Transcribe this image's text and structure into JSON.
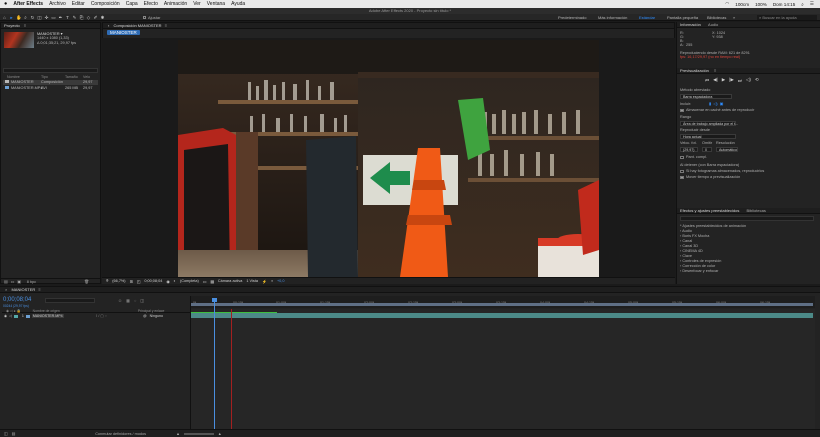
{
  "menubar": {
    "app": "After Effects",
    "items": [
      "Archivo",
      "Editar",
      "Composición",
      "Capa",
      "Efecto",
      "Animación",
      "Ver",
      "Ventana",
      "Ayuda"
    ],
    "zoom": "100%",
    "battery": "100cm",
    "clock": "Dom 14:15"
  },
  "window_title": "Adobe After Effects 2020 - Proyecto sin título *",
  "toolbar": {
    "align_label": "Ajustar",
    "workspaces": [
      "Predeterminado",
      "Más información",
      "Estándar",
      "Pantalla pequeña",
      "Bibliotecas"
    ],
    "active_workspace": "Estándar",
    "search_placeholder": "Buscar en la ayuda"
  },
  "project": {
    "tab": "Proyecto",
    "item_name": "MANIOSTER ▾",
    "item_meta": [
      "1440 x 1080 (1,33)",
      "Δ 0;01;35;21, 29,97 fps"
    ],
    "columns": [
      "Nombre",
      "Tipo",
      "Tamaño",
      "Velo"
    ],
    "rows": [
      {
        "name": "MANIOSTER",
        "type": "Composición",
        "size": "",
        "rate": "29,97"
      },
      {
        "name": "MANIOSTER.MP4",
        "type": "AVI",
        "size": "265 MB",
        "rate": "29,97"
      }
    ],
    "bpc": "8 bpc"
  },
  "composition": {
    "tab": "Composición MANIOSTER",
    "chip": "MANIOSTER",
    "viewer_bar": [
      "(66,7%)",
      "0;00;08;04",
      "(Completa)",
      "Cámara activa",
      "1 Vista",
      "+0,0"
    ]
  },
  "info_panel": {
    "tabs": [
      "Información",
      "Audio"
    ],
    "r_label": "R:",
    "g_label": "G:",
    "b_label": "B:",
    "a_label": "A:",
    "a_value": "255",
    "x_label": "X: 1024",
    "y_label": "Y: 938",
    "line1": "Reproduciendo desde RAM: 621 de 8291",
    "line2": "fps: 16,17/29,97 (no en tiempo real)"
  },
  "preview_panel": {
    "tab": "Previsualización",
    "shortcut_label": "Método abreviado",
    "shortcut_value": "Barra espaciadora",
    "include_label": "Incluir:",
    "cache_label": "Almacenar en caché antes de reproducir",
    "range_label": "Rango",
    "range_value": "Área de trabajo ampliada por el t...",
    "play_from_label": "Reproducir desde",
    "play_from_value": "Hora actual",
    "rate_label": "Veloc. fot.",
    "skip_label": "Omitir",
    "resolution_label": "Resolución",
    "rate_value": "(29,97)",
    "skip_value": "0",
    "res_value": "Automático",
    "fullscreen_label": "Pant. compl.",
    "stop_label": "Al detener (con Barra espaciadora)",
    "cached_label": "Si hay fotogramas almacenados, reproducirlos",
    "move_label": "Mover tiempo a previsualización"
  },
  "effects_panel": {
    "tabs": [
      "Efectos y ajustes preestablecidos",
      "Bibliotecas"
    ],
    "items": [
      "* Ajustes preestablecidos de animación",
      "› Audio",
      "› Boris FX Mocha",
      "› Canal",
      "› Canal 3D",
      "› CINEMA 4D",
      "› Clave",
      "› Controles de expresión",
      "› Corrección de color",
      "› Desenfocar y enfocar"
    ]
  },
  "timeline": {
    "tab": "MANIOSTER",
    "timecode": "0;00;08;04",
    "fps_sub": "00244 (29,97 fps)",
    "col_source": "Nombre de origen",
    "col_parent": "Principal y enlace",
    "layer_num": "1",
    "layer_name": "MANIOSTER.MP4",
    "parent_value": "Ninguno",
    "ticks": [
      "0f",
      "00:15f",
      "01:00f",
      "01:15f",
      "02:00f",
      "02:15f",
      "03:00f",
      "03:15f",
      "04:00f",
      "04:15f",
      "05:00f",
      "05:15f",
      "06:00f",
      "06:15f"
    ],
    "footer": "Conmutar definidores / modos"
  }
}
